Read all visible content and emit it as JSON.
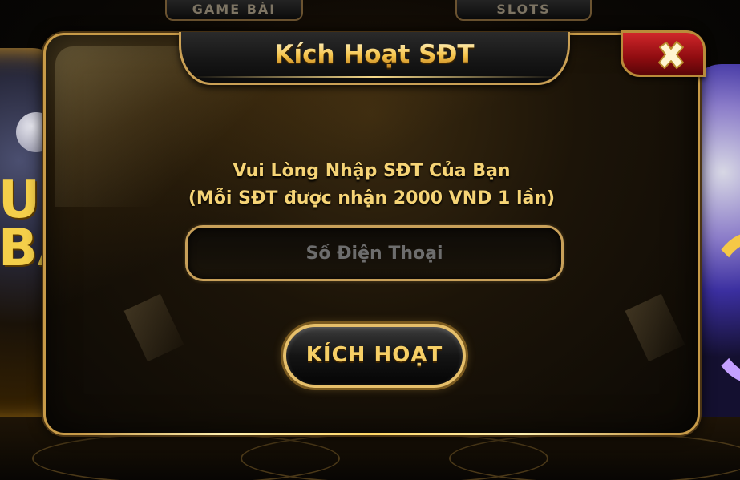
{
  "background": {
    "tabs": [
      "GAME BÀI",
      "SLOTS"
    ],
    "left_card_text": "U\nBA"
  },
  "dialog": {
    "title": "Kích Hoạt SĐT",
    "close_icon": "close-icon",
    "prompt_line1": "Vui Lòng Nhập SĐT Của Bạn",
    "prompt_line2": "(Mỗi SĐT được nhận 2000 VND 1 lần)",
    "phone_input": {
      "value": "",
      "placeholder": "Số Điện Thoại"
    },
    "activate_label": "KÍCH HOẠT"
  },
  "colors": {
    "accent_gold": "#f6cf66",
    "border_gold": "#c79a48",
    "close_red": "#b5161b"
  }
}
